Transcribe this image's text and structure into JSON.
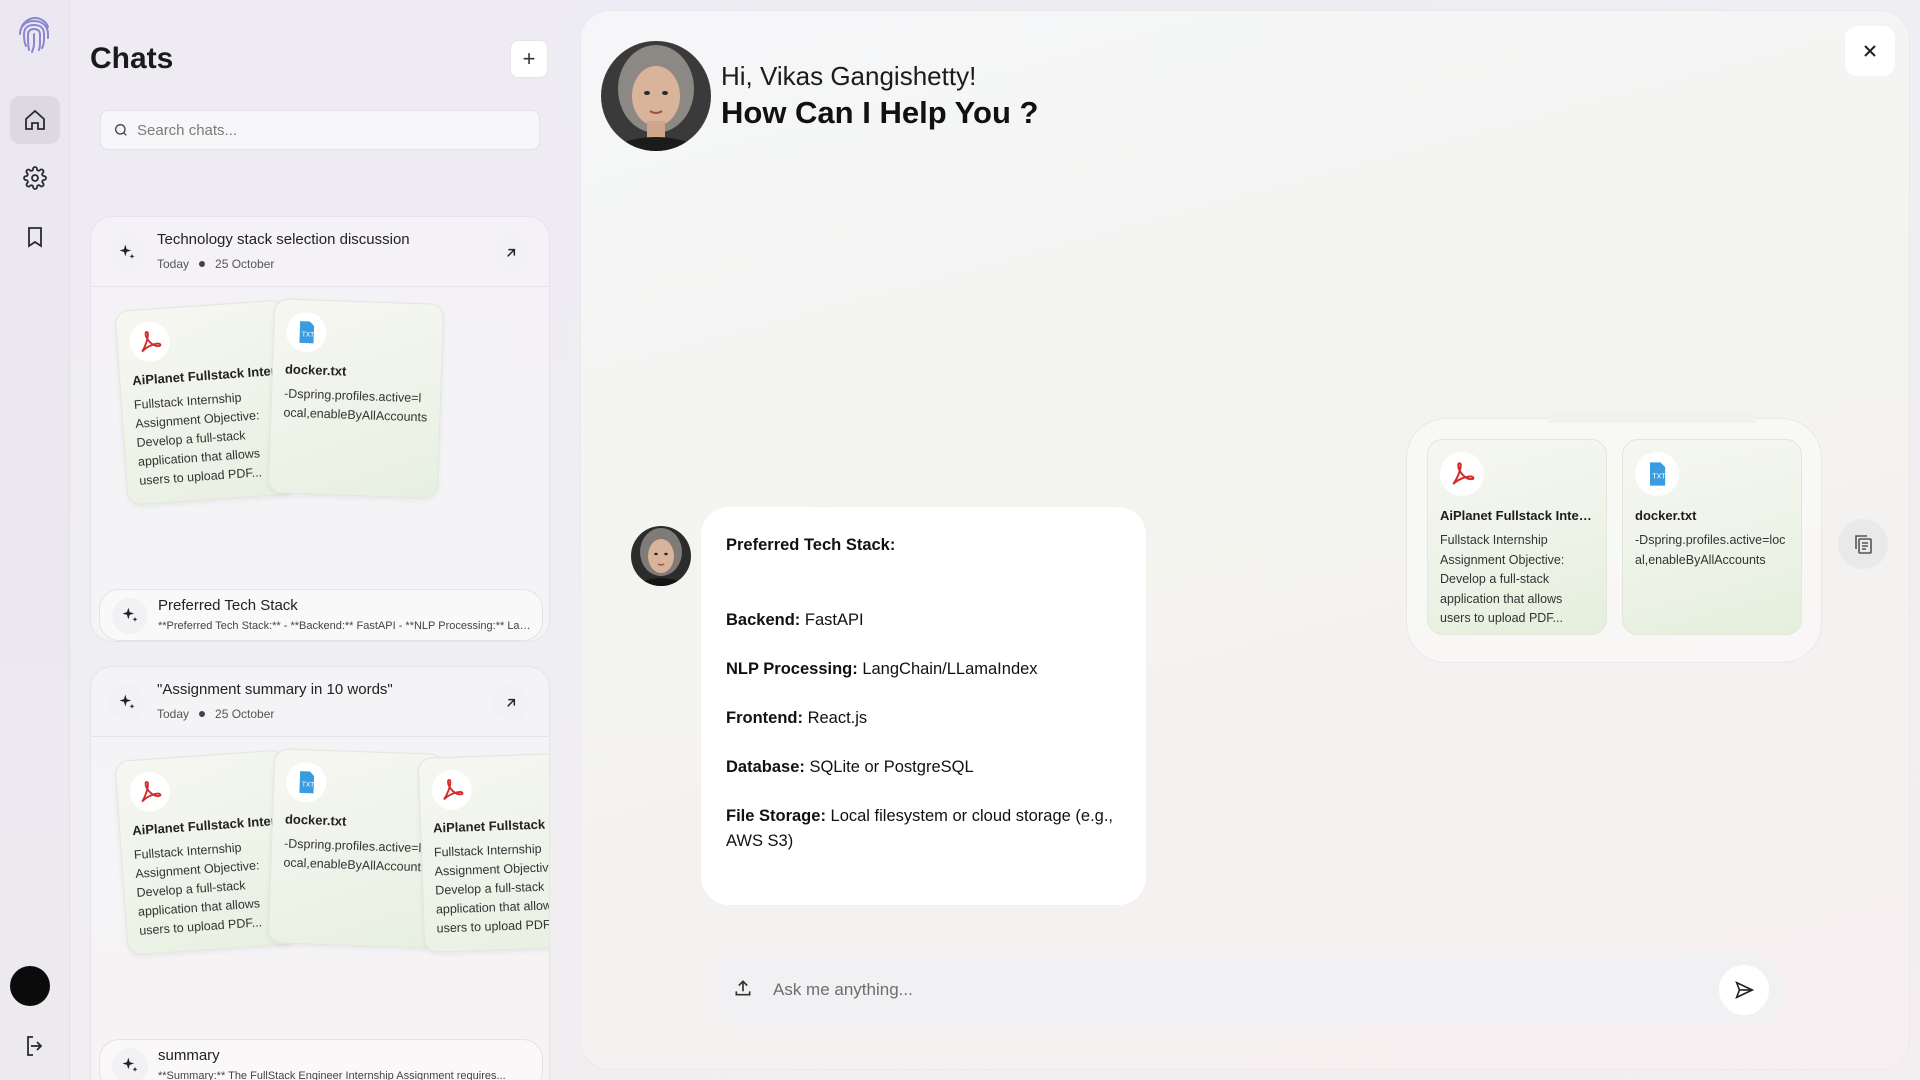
{
  "sidebar_rail": {
    "icons": [
      "fingerprint-logo",
      "home-icon",
      "settings-icon",
      "bookmark-icon",
      "user-avatar",
      "logout-icon"
    ]
  },
  "chats": {
    "title": "Chats",
    "new_label": "+",
    "search_placeholder": "Search chats...",
    "items": [
      {
        "title": "Technology stack selection discussion",
        "date_label": "Today",
        "date": "25 October",
        "docs": [
          {
            "type": "pdf",
            "name": "AiPlanet Fullstack Internship Assignment",
            "snippet": "Fullstack Internship Assignment Objective: Develop a full-stack application that allows users to upload PDF..."
          },
          {
            "type": "txt",
            "name": "docker.txt",
            "snippet": "-Dspring.profiles.active=local,enableByAllAccounts"
          }
        ],
        "summary_title": "Preferred Tech Stack",
        "summary_text": "**Preferred Tech Stack:** - **Backend:** FastAPI - **NLP Processing:** LangChain/LLamaIndex"
      },
      {
        "title": "\"Assignment summary in 10 words\"",
        "date_label": "Today",
        "date": "25 October",
        "docs": [
          {
            "type": "pdf",
            "name": "AiPlanet Fullstack Internship Assignment",
            "snippet": "Fullstack Internship Assignment Objective: Develop a full-stack application that allows users to upload PDF..."
          },
          {
            "type": "txt",
            "name": "docker.txt",
            "snippet": "-Dspring.profiles.active=local,enableByAllAccounts"
          },
          {
            "type": "pdf",
            "name": "AiPlanet Fullstack Internship Assignment",
            "snippet": "Fullstack Internship Assignment Objective: Develop a full-stack application that allows users to upload PDF..."
          }
        ],
        "summary_title": "summary",
        "summary_text": "**Summary:** The FullStack Engineer Internship Assignment requires..."
      }
    ]
  },
  "main": {
    "greeting": "Hi, Vikas Gangishetty!",
    "headline": "How Can I Help You ?",
    "message": {
      "heading": "Preferred Tech Stack:",
      "lines": [
        {
          "label": "Backend:",
          "value": "FastAPI"
        },
        {
          "label": "NLP Processing:",
          "value": "LangChain/LLamaIndex"
        },
        {
          "label": "Frontend:",
          "value": "React.js"
        },
        {
          "label": "Database:",
          "value": "SQLite or PostgreSQL"
        },
        {
          "label": "File Storage:",
          "value": "Local filesystem or cloud storage (e.g., AWS S3)"
        }
      ]
    },
    "attachments": [
      {
        "type": "pdf",
        "name": "AiPlanet Fullstack Intern...",
        "snippet": "Fullstack Internship Assignment Objective: Develop a full-stack application that allows users to upload PDF..."
      },
      {
        "type": "txt",
        "name": "docker.txt",
        "snippet": "-Dspring.profiles.active=local,enableByAllAccounts"
      }
    ],
    "composer_placeholder": "Ask me anything..."
  },
  "colors": {
    "pdf_red": "#d42a2a",
    "txt_blue": "#3b9be0",
    "bubble_bg": "#ffffff"
  }
}
